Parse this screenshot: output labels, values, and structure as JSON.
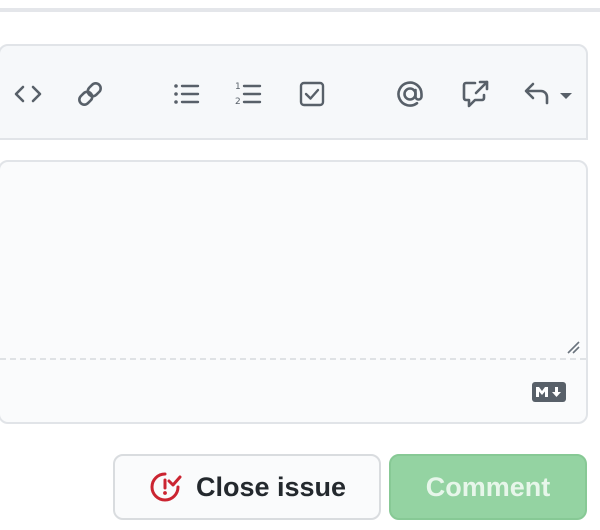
{
  "toolbar": {
    "items": [
      {
        "icon": "code-icon"
      },
      {
        "icon": "link-icon"
      },
      {
        "icon": "unordered-list-icon"
      },
      {
        "icon": "ordered-list-icon"
      },
      {
        "icon": "task-list-icon"
      },
      {
        "icon": "mention-icon"
      },
      {
        "icon": "cross-reference-icon"
      },
      {
        "icon": "saved-reply-icon"
      }
    ]
  },
  "editor": {
    "value": "",
    "markdown_badge": "MD"
  },
  "actions": {
    "close_issue_label": "Close issue",
    "comment_label": "Comment",
    "comment_disabled": true
  },
  "colors": {
    "close_icon": "#cb2431",
    "comment_button_bg": "#94d3a2",
    "icon_gray": "#586069"
  }
}
